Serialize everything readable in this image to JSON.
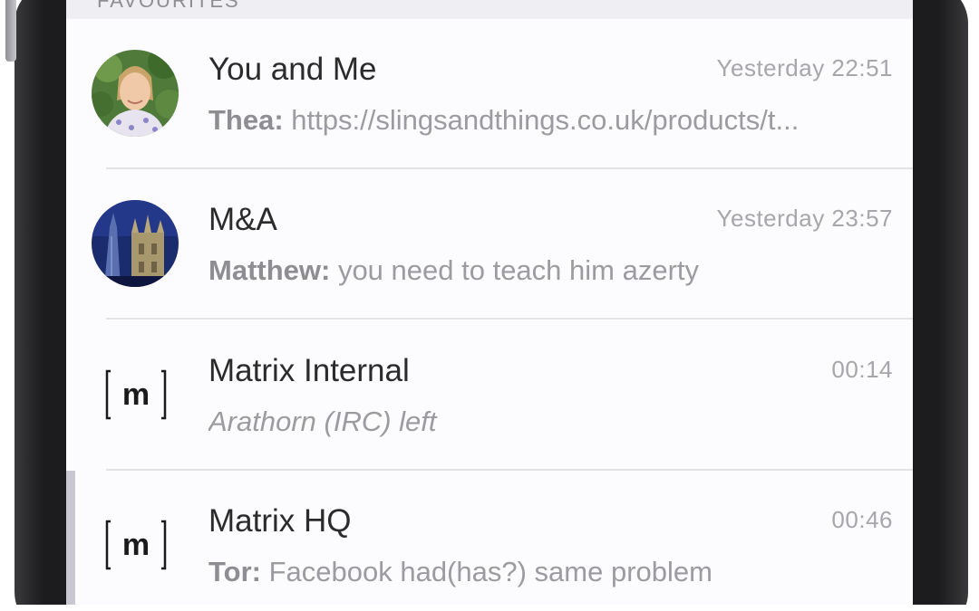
{
  "section_header": {
    "label": "FAVOURITES"
  },
  "rooms": [
    {
      "name": "You and Me",
      "time": "Yesterday 22:51",
      "sender": "Thea:",
      "message": " https://slingsandthings.co.uk/products/t...",
      "avatar": "photo-avatar-woman"
    },
    {
      "name": "M&A",
      "time": "Yesterday 23:57",
      "sender": "Matthew:",
      "message": " you need to teach him azerty",
      "avatar": "photo-avatar-city-night"
    },
    {
      "name": "Matrix Internal",
      "time": "00:14",
      "event": "Arathorn (IRC) left",
      "avatar": "matrix-logo-icon",
      "logo_text": "m"
    },
    {
      "name": "Matrix HQ",
      "time": "00:46",
      "sender": "Tor:",
      "message": " Facebook had(has?) same problem",
      "avatar": "matrix-logo-icon",
      "logo_text": "m"
    }
  ],
  "colors": {
    "frame": "#1c1c1e",
    "screen_bg": "#fcfbfd",
    "header_bg": "#efeef3",
    "name_text": "#2b2b2b",
    "preview_text": "#9b9ba0",
    "time_text": "#a6a6ab",
    "separator": "#e3e2e7",
    "unread_marker": "#c9c7cf"
  }
}
